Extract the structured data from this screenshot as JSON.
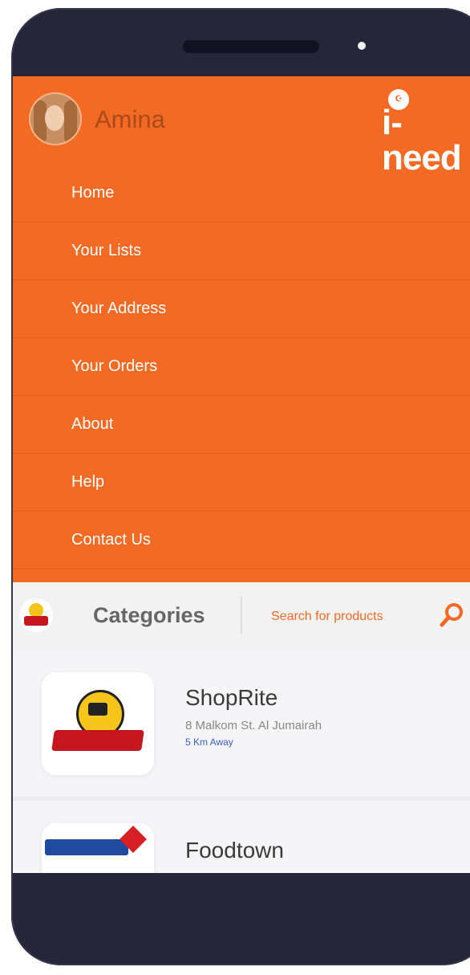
{
  "user": {
    "name": "Amina"
  },
  "app_logo": {
    "text": "i-need",
    "badge": "ﷺ"
  },
  "menu": {
    "items": [
      {
        "label": "Home"
      },
      {
        "label": "Your Lists"
      },
      {
        "label": "Your Address"
      },
      {
        "label": "Your Orders"
      },
      {
        "label": "About"
      },
      {
        "label": "Help"
      },
      {
        "label": "Contact Us"
      }
    ]
  },
  "search": {
    "categories_label": "Categories",
    "placeholder": "Search for products"
  },
  "stores": [
    {
      "name": "ShopRite",
      "address": "8 Malkom St. Al Jumairah",
      "distance": "5 Km Away"
    },
    {
      "name": "Foodtown",
      "address": "",
      "distance": ""
    }
  ],
  "colors": {
    "accent": "#f26a23",
    "device_frame": "#25263a",
    "link": "#3a5fc9"
  },
  "icons": [
    "avatar",
    "ineed-logo",
    "store-logo-icon",
    "search-icon",
    "shoprite-logo",
    "foodtown-logo"
  ]
}
